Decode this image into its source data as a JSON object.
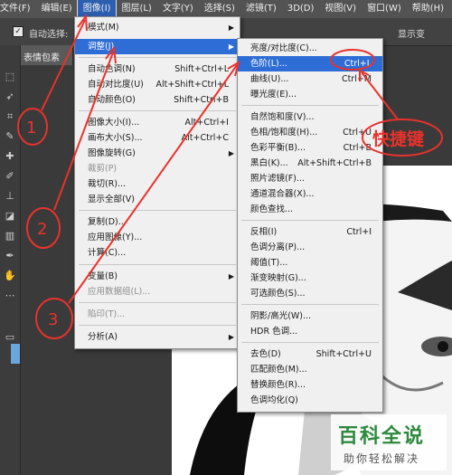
{
  "menubar": {
    "items": [
      "文件(F)",
      "编辑(E)",
      "图像(I)",
      "图层(L)",
      "文字(Y)",
      "选择(S)",
      "滤镜(T)",
      "3D(D)",
      "视图(V)",
      "窗口(W)",
      "帮助(H)"
    ],
    "active": "图像(I)"
  },
  "options_bar": {
    "auto_select_label": "自动选择:",
    "right_text": "显示变"
  },
  "doc_tab": {
    "title": "表情包素"
  },
  "image_menu": {
    "items": [
      {
        "label": "模式(M)",
        "shortcut": "",
        "submenu": true,
        "disabled": false
      },
      {
        "label": "调整(J)",
        "shortcut": "",
        "submenu": true,
        "disabled": false,
        "highlighted": true
      },
      {
        "label": "自动色调(N)",
        "shortcut": "Shift+Ctrl+L"
      },
      {
        "label": "自动对比度(U)",
        "shortcut": "Alt+Shift+Ctrl+L"
      },
      {
        "label": "自动颜色(O)",
        "shortcut": "Shift+Ctrl+B"
      },
      {
        "label": "图像大小(I)...",
        "shortcut": "Alt+Ctrl+I"
      },
      {
        "label": "画布大小(S)...",
        "shortcut": "Alt+Ctrl+C"
      },
      {
        "label": "图像旋转(G)",
        "shortcut": "",
        "submenu": true
      },
      {
        "label": "裁剪(P)",
        "shortcut": "",
        "disabled": true
      },
      {
        "label": "裁切(R)...",
        "shortcut": ""
      },
      {
        "label": "显示全部(V)",
        "shortcut": ""
      },
      {
        "label": "复制(D)...",
        "shortcut": ""
      },
      {
        "label": "应用图像(Y)...",
        "shortcut": ""
      },
      {
        "label": "计算(C)...",
        "shortcut": ""
      },
      {
        "label": "变量(B)",
        "shortcut": "",
        "submenu": true
      },
      {
        "label": "应用数据组(L)...",
        "shortcut": "",
        "disabled": true
      },
      {
        "label": "陷印(T)...",
        "shortcut": "",
        "disabled": true
      },
      {
        "label": "分析(A)",
        "shortcut": "",
        "submenu": true
      }
    ]
  },
  "adjust_menu": {
    "items": [
      {
        "label": "亮度/对比度(C)...",
        "shortcut": ""
      },
      {
        "label": "色阶(L)...",
        "shortcut": "Ctrl+L",
        "highlighted": true
      },
      {
        "label": "曲线(U)...",
        "shortcut": "Ctrl+M"
      },
      {
        "label": "曝光度(E)...",
        "shortcut": ""
      },
      {
        "label": "自然饱和度(V)...",
        "shortcut": ""
      },
      {
        "label": "色相/饱和度(H)...",
        "shortcut": "Ctrl+U"
      },
      {
        "label": "色彩平衡(B)...",
        "shortcut": "Ctrl+B"
      },
      {
        "label": "黑白(K)...",
        "shortcut": "Alt+Shift+Ctrl+B"
      },
      {
        "label": "照片滤镜(F)...",
        "shortcut": ""
      },
      {
        "label": "通道混合器(X)...",
        "shortcut": ""
      },
      {
        "label": "颜色查找...",
        "shortcut": ""
      },
      {
        "label": "反相(I)",
        "shortcut": "Ctrl+I"
      },
      {
        "label": "色调分离(P)...",
        "shortcut": ""
      },
      {
        "label": "阈值(T)...",
        "shortcut": ""
      },
      {
        "label": "渐变映射(G)...",
        "shortcut": ""
      },
      {
        "label": "可选颜色(S)...",
        "shortcut": ""
      },
      {
        "label": "阴影/高光(W)...",
        "shortcut": ""
      },
      {
        "label": "HDR 色调...",
        "shortcut": ""
      },
      {
        "label": "去色(D)",
        "shortcut": "Shift+Ctrl+U"
      },
      {
        "label": "匹配颜色(M)...",
        "shortcut": ""
      },
      {
        "label": "替换颜色(R)...",
        "shortcut": ""
      },
      {
        "label": "色调均化(Q)",
        "shortcut": ""
      }
    ]
  },
  "annotations": {
    "step1": "1",
    "step2": "2",
    "step3": "3",
    "shortcut_note": "快捷键",
    "color": "#e8322c"
  },
  "watermark": {
    "title": "百科全说",
    "subtitle": "助你轻松解决"
  }
}
